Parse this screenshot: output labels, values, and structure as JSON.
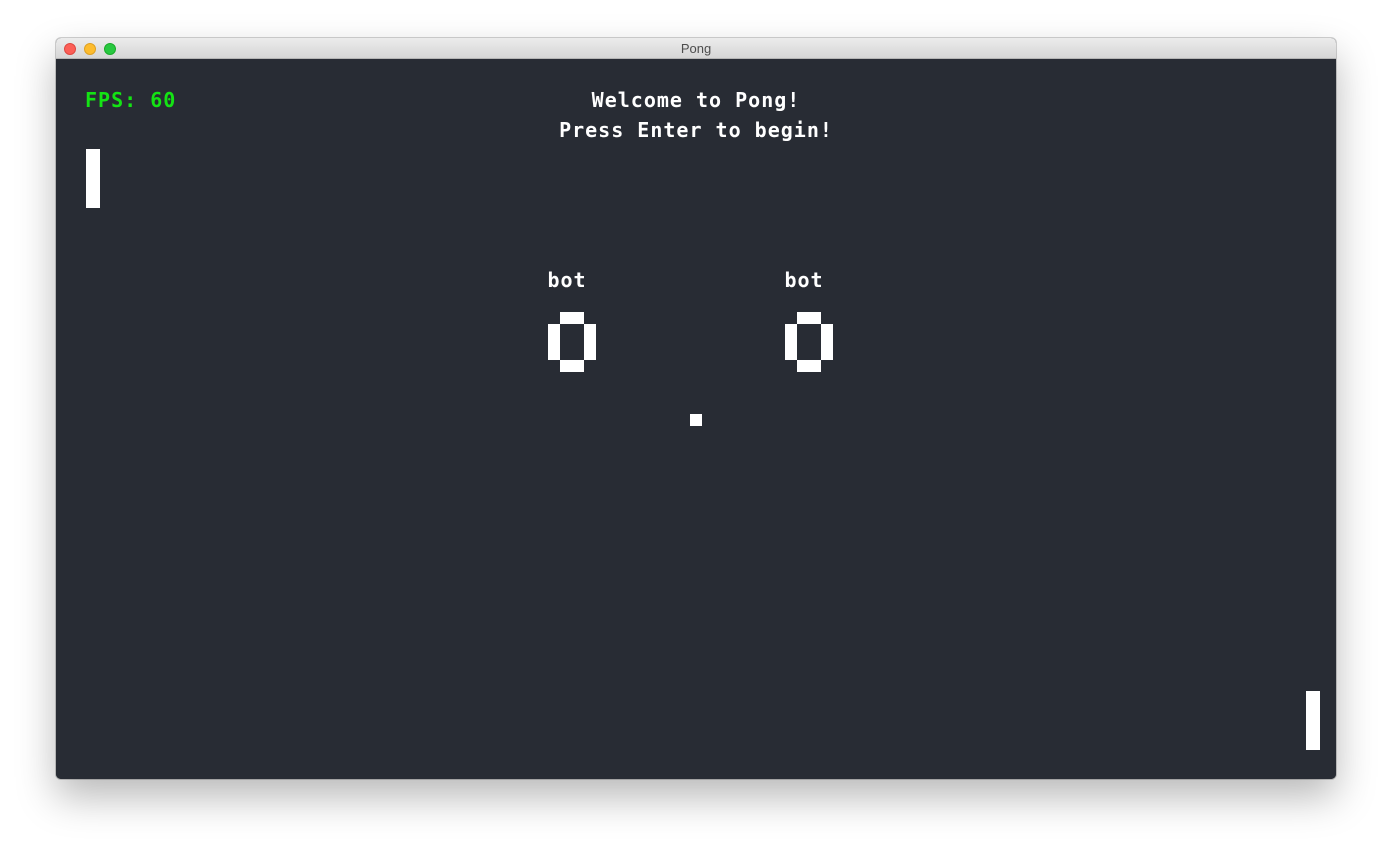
{
  "window": {
    "title": "Pong"
  },
  "hud": {
    "fps_label": "FPS: 60"
  },
  "messages": {
    "line1": "Welcome to Pong!",
    "line2": "Press Enter to begin!"
  },
  "players": [
    {
      "name": "bot",
      "score": "0"
    },
    {
      "name": "bot",
      "score": "0"
    }
  ],
  "colors": {
    "background": "#282c34",
    "foreground": "#ffffff",
    "fps": "#14e314"
  }
}
